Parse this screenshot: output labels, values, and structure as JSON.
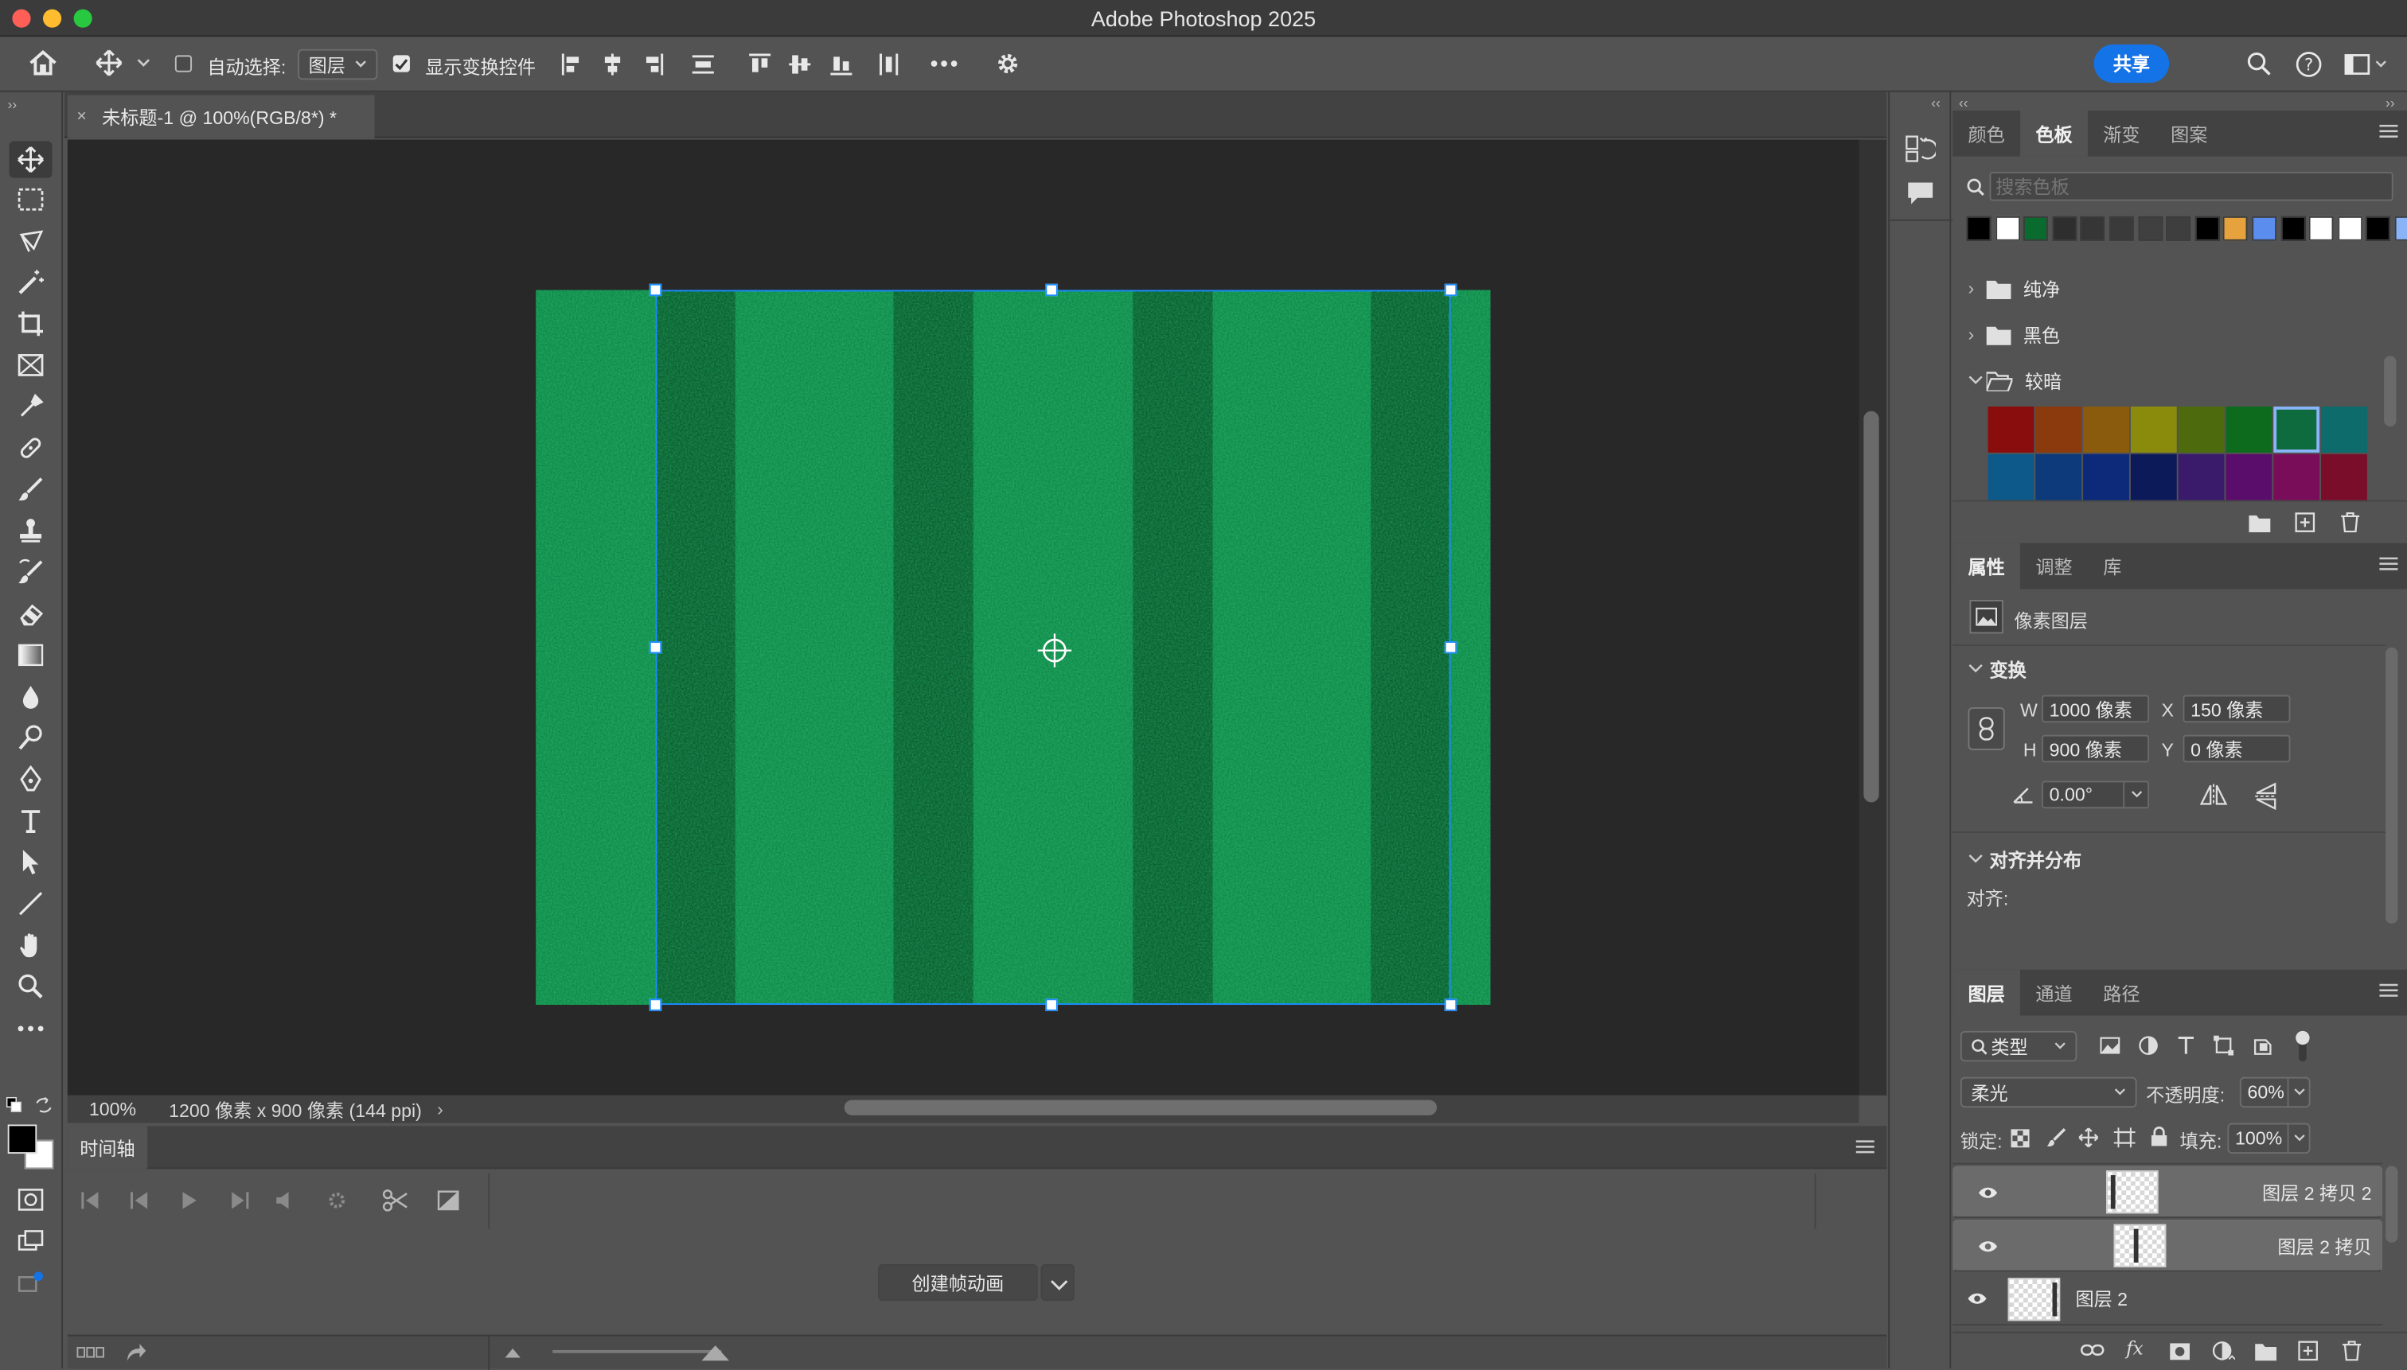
{
  "app_title": "Adobe Photoshop 2025",
  "options_bar": {
    "auto_select_label": "自动选择:",
    "auto_select_value": "图层",
    "show_transform_label": "显示变换控件",
    "share_label": "共享"
  },
  "document": {
    "tab_title": "未标题-1 @ 100%(RGB/8*) *",
    "zoom": "100%",
    "doc_info": "1200 像素 x 900 像素 (144 ppi)"
  },
  "timeline": {
    "title": "时间轴",
    "create_button": "创建帧动画"
  },
  "swatches_panel": {
    "tabs": [
      "颜色",
      "色板",
      "渐变",
      "图案"
    ],
    "active_tab": "色板",
    "search_placeholder": "搜索色板",
    "recent_colors": [
      "#000000",
      "#ffffff",
      "#0a6b2e",
      "#2e2e2e",
      "#363636",
      "#3a3a3a",
      "#404040",
      "#3e3e3e",
      "#000000",
      "#e6a23c",
      "#5b8def",
      "#000000",
      "#ffffff",
      "#ffffff",
      "#000000",
      "#8ab4f8"
    ],
    "groups": [
      {
        "name": "纯净",
        "expanded": false
      },
      {
        "name": "黑色",
        "expanded": false
      },
      {
        "name": "较暗",
        "expanded": true
      }
    ],
    "darker_swatches_row1": [
      "#8a0d0d",
      "#8a3a0d",
      "#8a5a0d",
      "#8a8a0d",
      "#4d6b0d",
      "#0d6b1e",
      "#0d6b3e",
      "#0d6b6b"
    ],
    "darker_swatches_row2": [
      "#0d5a8a",
      "#0d3a7a",
      "#0d2a7a",
      "#0d1a5a",
      "#3a1a6b",
      "#5a0d6b",
      "#7a0d5a",
      "#7a0d2a"
    ]
  },
  "properties_panel": {
    "tabs": [
      "属性",
      "调整",
      "库"
    ],
    "active_tab": "属性",
    "layer_type": "像素图层",
    "transform_title": "变换",
    "w_label": "W",
    "w_value": "1000 像素",
    "h_label": "H",
    "h_value": "900 像素",
    "x_label": "X",
    "x_value": "150 像素",
    "y_label": "Y",
    "y_value": "0 像素",
    "angle_value": "0.00°",
    "align_title": "对齐并分布",
    "align_label": "对齐:"
  },
  "layers_panel": {
    "tabs": [
      "图层",
      "通道",
      "路径"
    ],
    "active_tab": "图层",
    "filter_value": "类型",
    "blend_mode": "柔光",
    "opacity_label": "不透明度:",
    "opacity_value": "60%",
    "lock_label": "锁定:",
    "fill_label": "填充:",
    "fill_value": "100%",
    "layers": [
      {
        "name": "图层 2 拷贝 2",
        "selected": true,
        "visible": true
      },
      {
        "name": "图层 2 拷贝",
        "selected": true,
        "visible": true
      },
      {
        "name": "图层 2",
        "selected": false,
        "visible": true
      }
    ]
  },
  "colors": {
    "accent_blue": "#1473e6",
    "grass_light": "#0f8a48",
    "grass_dark": "#07572a"
  }
}
